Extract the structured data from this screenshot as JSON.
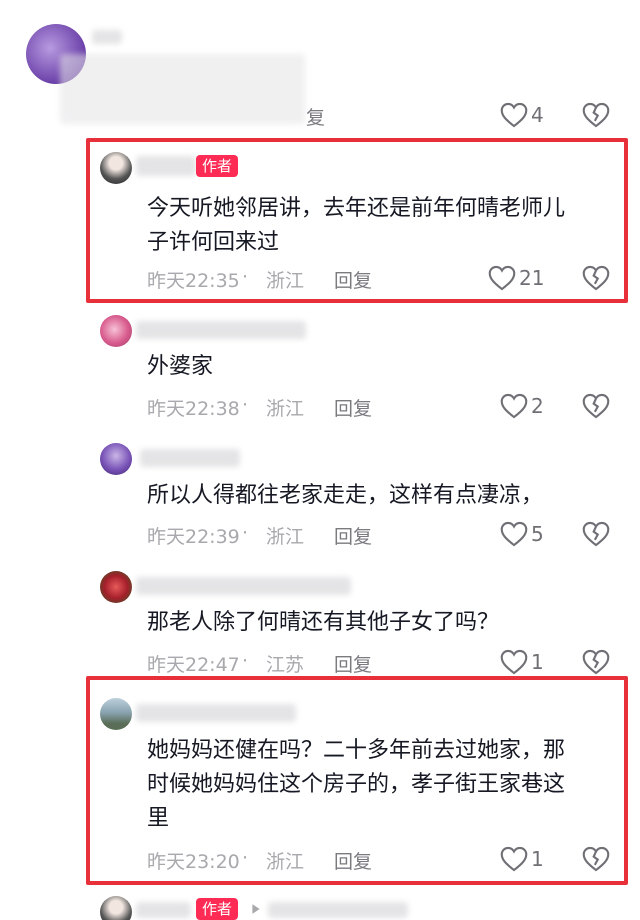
{
  "comments": [
    {
      "reply_label": "复",
      "likes": "4"
    },
    {
      "author_badge": "作者",
      "text_lines": [
        "今天听她邻居讲，去年还是前年何晴老师儿",
        "子许何回来过"
      ],
      "time": "昨天22:35",
      "location": "浙江",
      "reply_label": "回复",
      "likes": "21"
    },
    {
      "text_lines": [
        "外婆家"
      ],
      "time": "昨天22:38",
      "location": "浙江",
      "reply_label": "回复",
      "likes": "2"
    },
    {
      "text_lines": [
        "所以人得都往老家走走，这样有点凄凉，"
      ],
      "time": "昨天22:39",
      "location": "浙江",
      "reply_label": "回复",
      "likes": "5"
    },
    {
      "text_lines": [
        "那老人除了何晴还有其他子女了吗？"
      ],
      "time": "昨天22:47",
      "location": "江苏",
      "reply_label": "回复",
      "likes": "1"
    },
    {
      "text_lines": [
        "她妈妈还健在吗？二十多年前去过她家，那",
        "时候她妈妈住这个房子的，孝子街王家巷这",
        "里"
      ],
      "time": "昨天23:20",
      "location": "浙江",
      "reply_label": "回复",
      "likes": "1"
    },
    {
      "author_badge": "作者"
    }
  ],
  "separator": " · ",
  "icons": {
    "like": "heart-outline-icon",
    "dislike": "broken-heart-icon"
  },
  "colors": {
    "highlight": "#e8303a",
    "author_badge": "#fe2c55",
    "meta": "#a8a8ad"
  }
}
